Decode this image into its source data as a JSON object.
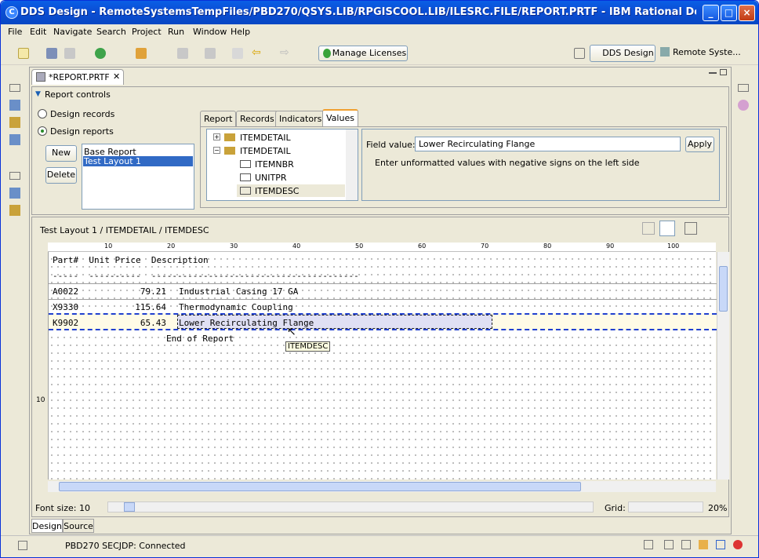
{
  "window": {
    "title": "DDS Design - RemoteSystemsTempFiles/PBD270/QSYS.LIB/RPGISCOOL.LIB/ILESRC.FILE/REPORT.PRTF - IBM Rational Developer for Power S...",
    "app_glyph": "C"
  },
  "menu": [
    "File",
    "Edit",
    "Navigate",
    "Search",
    "Project",
    "Run",
    "Window",
    "Help"
  ],
  "toolbar": {
    "manage_licenses": "Manage Licenses",
    "perspectives": [
      "DDS Design",
      "Remote Syste..."
    ]
  },
  "editor": {
    "tab": "*REPORT.PRTF",
    "section": "Report controls"
  },
  "controls": {
    "radio_records": "Design records",
    "radio_reports": "Design reports",
    "new": "New",
    "delete": "Delete",
    "layouts": [
      "Base Report",
      "Test Layout 1"
    ],
    "tabs": [
      "Report",
      "Records",
      "Indicators",
      "Values"
    ],
    "tree": [
      "ITEMDETAIL",
      "ITEMDETAIL",
      "ITEMNBR",
      "UNITPR",
      "ITEMDESC"
    ],
    "field_value_label": "Field value:",
    "field_value": "Lower Recirculating Flange",
    "apply": "Apply",
    "hint": "Enter unformatted values with negative signs on the left side"
  },
  "design": {
    "breadcrumb": "Test Layout 1 / ITEMDETAIL / ITEMDESC",
    "ruler": [
      "10",
      "20",
      "30",
      "40",
      "50",
      "60",
      "70",
      "80",
      "90",
      "100"
    ],
    "header": "Part#  Unit Price  Description",
    "dashes": "-----  ----------  ----------------------------------------",
    "rows": [
      {
        "part": "A0022",
        "price": "79.21",
        "desc": "Industrial Casing 17 GA"
      },
      {
        "part": "X9330",
        "price": "115.64",
        "desc": "Thermodynamic Coupling"
      },
      {
        "part": "K9902",
        "price": "65.43",
        "desc": "Lower Recirculating Flange"
      }
    ],
    "end": "End of Report",
    "tooltip": "ITEMDESC",
    "line_number": "10",
    "font_size": "Font size: 10",
    "grid_label": "Grid:",
    "zoom": "20%",
    "bottom_tabs": [
      "Design",
      "Source"
    ]
  },
  "status": {
    "connection": "PBD270 SECJDP: Connected"
  }
}
